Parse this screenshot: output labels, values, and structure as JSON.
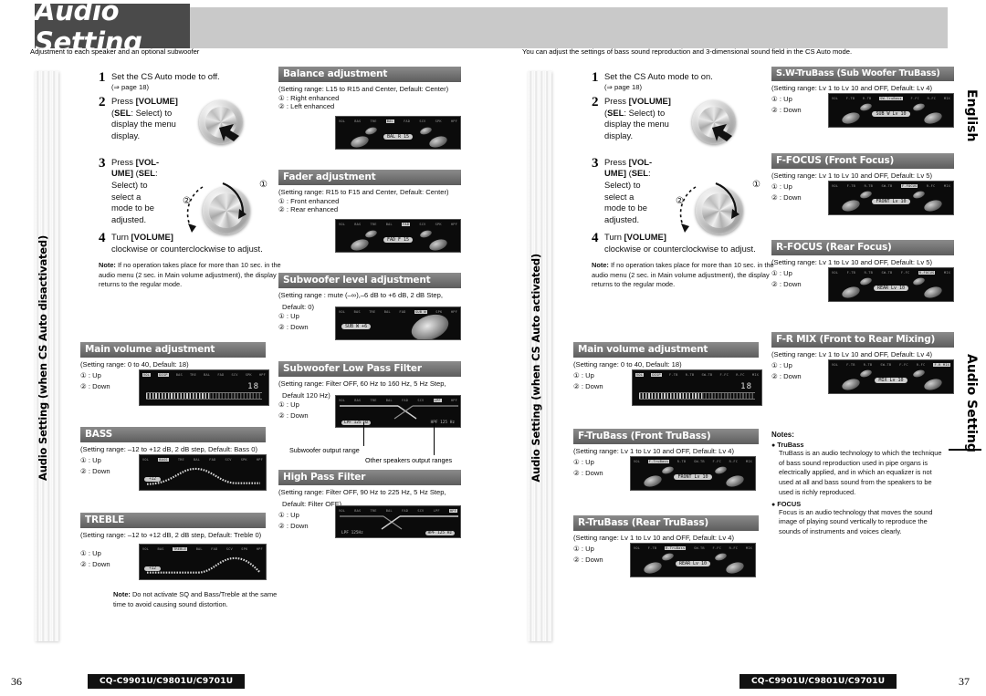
{
  "header": {
    "title": "Audio Setting",
    "subtitle_left": "Adjustment to each speaker and an optional subwoofer",
    "subtitle_right": "You can adjust the settings of bass sound reproduction and 3-dimensional sound field in the CS Auto mode."
  },
  "side_tabs": {
    "left": "Audio Setting (when CS Auto disactivated)",
    "right": "Audio Setting (when CS Auto activated)",
    "english": "English",
    "audio_setting": "Audio Setting"
  },
  "steps_left": {
    "s1_num": "1",
    "s1_text": "Set the CS Auto mode to off.",
    "s1_sub": "(⇒ page 18)",
    "s2_num": "2",
    "s2_text_a": "Press ",
    "s2_text_b": "[VOLUME]",
    "s2_text_c": "(",
    "s2_text_d": "SEL",
    "s2_text_e": ": Select) to display the menu display.",
    "s3_num": "3",
    "s3_text_a": "Press ",
    "s3_text_b": "[VOL-UME]",
    "s3_text_c": " (",
    "s3_text_d": "SEL",
    "s3_text_e": ": Select) to select a mode to be adjusted.",
    "s4_num": "4",
    "s4_text_a": "Turn ",
    "s4_text_b": "[VOLUME]",
    "s4_text_c": "clockwise or counterclockwise to adjust.",
    "note_label": "Note:",
    "note_text": " If no operation takes place for more than 10 sec. in the audio menu (2 sec. in Main volume adjustment), the display returns to the regular mode.",
    "knob_marks": {
      "one": "①",
      "two": "②"
    }
  },
  "steps_right": {
    "s1_num": "1",
    "s1_text": "Set the CS Auto mode to on.",
    "s1_sub": "(⇒ page 18)",
    "s2_num": "2",
    "s2_text_a": "Press ",
    "s2_text_b": "[VOLUME]",
    "s2_text_c": "(",
    "s2_text_d": "SEL",
    "s2_text_e": ": Select) to display the menu display.",
    "s3_num": "3",
    "s3_text_a": "Press ",
    "s3_text_b": "[VOL-UME]",
    "s3_text_c": " (",
    "s3_text_d": "SEL",
    "s3_text_e": ": Select) to select a mode to be adjusted.",
    "s4_num": "4",
    "s4_text_a": "Turn ",
    "s4_text_b": "[VOLUME]",
    "s4_text_c": "clockwise or counterclockwise to adjust.",
    "note_label": "Note:",
    "note_text": " If no operation takes place for more than 10 sec. in the audio menu (2 sec. in Main volume adjustment), the display returns to the regular mode."
  },
  "col1": {
    "main_volume": {
      "title": "Main volume adjustment",
      "range": "(Setting range: 0 to 40, Default: 18)",
      "opt1": "① : Up",
      "opt2": "② : Down",
      "lcd_top": [
        "VOL",
        "DISP",
        "BAS",
        "TRE",
        "BAL",
        "FAD",
        "SCV",
        "SPK",
        "HPF"
      ],
      "lcd_value": "18"
    },
    "bass": {
      "title": "BASS",
      "range": "(Setting range: –12 to +12 dB, 2 dB step, Default: Bass 0)",
      "opt1": "① : Up",
      "opt2": "② : Down",
      "lcd_top": [
        "VOL",
        "BASS",
        "TRE",
        "BAL",
        "FAD",
        "SCV",
        "SPK",
        "HPF"
      ],
      "lcd_tag": "+12"
    },
    "treble": {
      "title": "TREBLE",
      "range": "(Setting range: –12 to +12 dB, 2 dB step, Default: Treble 0)",
      "opt1": "① : Up",
      "opt2": "② : Down",
      "lcd_top": [
        "VOL",
        "BAS",
        "TREBLE",
        "BAL",
        "FAD",
        "SCV",
        "SPK",
        "HPF"
      ],
      "lcd_tag": "+12"
    },
    "bottom_note_label": "Note:",
    "bottom_note_text": " Do not activate SQ and Bass/Treble at the same time to avoid causing sound distortion."
  },
  "col2": {
    "balance": {
      "title": "Balance adjustment",
      "range": "(Setting range: L15 to R15 and Center, Default: Center)",
      "opt1": "① : Right enhanced",
      "opt2": "② : Left enhanced",
      "lcd_top": [
        "VOL",
        "BAS",
        "TRE",
        "BAL",
        "FAD",
        "SCV",
        "SPK",
        "HPF"
      ],
      "lcd_pill": "BAL R 15"
    },
    "fader": {
      "title": "Fader adjustment",
      "range": "(Setting range: R15 to F15 and Center, Default: Center)",
      "opt1": "① : Front enhanced",
      "opt2": "② : Rear enhanced",
      "lcd_top": [
        "VOL",
        "BAS",
        "TRE",
        "BAL",
        "FAD",
        "SCV",
        "SPK",
        "HPF"
      ],
      "lcd_pill": "FAD F 15"
    },
    "subwoofer_level": {
      "title": "Subwoofer level adjustment",
      "range": "(Setting range : mute (–∞),–6 dB to +6 dB, 2 dB Step,",
      "range2": "Default: 0)",
      "opt1": "① : Up",
      "opt2": "② : Down",
      "lcd_top": [
        "VOL",
        "BAS",
        "TRE",
        "BAL",
        "FAD",
        "SUB W",
        "SPK",
        "HPF"
      ],
      "lcd_pill": "SUB W  +6"
    },
    "sub_lpf": {
      "title": "Subwoofer Low Pass Filter",
      "range": "(Setting range: Filter OFF, 60 Hz to 160 Hz, 5 Hz Step,",
      "range2": "Default 120 Hz)",
      "opt1": "① : Up",
      "opt2": "② : Down",
      "lcd_top": [
        "VOL",
        "BAS",
        "TRE",
        "BAL",
        "FAD",
        "SCV",
        "LPF",
        "HPF"
      ],
      "lcd_left": "LPF  125 Hz",
      "lcd_right": "HPF   125 Hz",
      "callout_a": "Subwoofer output range",
      "callout_b": "Other speakers output ranges"
    },
    "hpf": {
      "title": "High Pass Filter",
      "range": "(Setting range: Filter OFF, 90 Hz to 225 Hz, 5 Hz Step,",
      "range2": "Default: Filter OFF)",
      "opt1": "① : Up",
      "opt2": "② : Down",
      "lcd_top": [
        "VOL",
        "BAS",
        "TRE",
        "BAL",
        "FAD",
        "SCV",
        "LPF",
        "HPF"
      ],
      "lcd_left": "LPF   125Hz",
      "lcd_right": "HPF   125 Hz"
    }
  },
  "col3": {
    "main_volume": {
      "title": "Main volume adjustment",
      "range": "(Setting range: 0 to 40, Default: 18)",
      "opt1": "① : Up",
      "opt2": "② : Down",
      "lcd_top": [
        "VOL",
        "DISP",
        "F-TB",
        "R-TB",
        "SW-TB",
        "F-FC",
        "R-FC",
        "MIX"
      ],
      "lcd_value": "18"
    },
    "f_trubass": {
      "title": "F-TruBass (Front TruBass)",
      "range": "(Setting range: Lv 1 to Lv 10 and OFF, Default: Lv 4)",
      "opt1": "① : Up",
      "opt2": "② : Down",
      "lcd_top": [
        "VOL",
        "F-TruBass",
        "R-TB",
        "SW-TB",
        "F-FC",
        "R-FC",
        "MIX"
      ],
      "lcd_pill": "FRONT  Lv 10"
    },
    "r_trubass": {
      "title": "R-TruBass (Rear TruBass)",
      "range": "(Setting range: Lv 1 to Lv 10 and OFF, Default: Lv 4)",
      "opt1": "① : Up",
      "opt2": "② : Down",
      "lcd_top": [
        "VOL",
        "F-TB",
        "R-TruBass",
        "SW-TB",
        "F-FC",
        "R-FC",
        "MIX"
      ],
      "lcd_pill": "REAR  Lv 10"
    }
  },
  "col4": {
    "sw_trubass": {
      "title": "S.W-TruBass (Sub Woofer TruBass)",
      "range": "(Setting range: Lv 1 to Lv 10 and OFF, Default: Lv 4)",
      "opt1": "① : Up",
      "opt2": "② : Down",
      "lcd_top": [
        "VOL",
        "F-TB",
        "R-TB",
        "SW-TruBass",
        "F-FC",
        "R-FC",
        "MIX"
      ],
      "lcd_pill": "SUB W  Lv 10"
    },
    "f_focus": {
      "title": "F-FOCUS (Front Focus)",
      "range": "(Setting range: Lv 1 to Lv 10 and OFF, Default: Lv 5)",
      "opt1": "① : Up",
      "opt2": "② : Down",
      "lcd_top": [
        "VOL",
        "F-TB",
        "R-TB",
        "SW-TB",
        "F-FOCUS",
        "R-FC",
        "MIX"
      ],
      "lcd_pill": "FRONT  Lv 10"
    },
    "r_focus": {
      "title": "R-FOCUS (Rear Focus)",
      "range": "(Setting range: Lv 1 to Lv 10 and OFF, Default: Lv 5)",
      "opt1": "① : Up",
      "opt2": "② : Down",
      "lcd_top": [
        "VOL",
        "F-TB",
        "R-TB",
        "SW-TB",
        "F-FC",
        "R-FOCUS",
        "MIX"
      ],
      "lcd_pill": "REAR  Lv 10"
    },
    "fr_mix": {
      "title": "F-R MIX (Front to Rear Mixing)",
      "range": "(Setting range: Lv 1 to Lv 10 and OFF, Default: Lv 4)",
      "opt1": "① : Up",
      "opt2": "② : Down",
      "lcd_top": [
        "VOL",
        "F-TB",
        "R-TB",
        "SW-TB",
        "F-FC",
        "R-FC",
        "F-R MIX"
      ],
      "lcd_pill": "MIX  Lv 10"
    },
    "notes": {
      "head": "Notes:",
      "item1_title": "TruBass",
      "item1_body": "TruBass is an audio technology to which the technique of bass sound reproduction used in pipe organs is electrically applied, and in which an equalizer is not used at all and bass sound from the speakers to be used is richly reproduced.",
      "item2_title": "FOCUS",
      "item2_body": "Focus is an audio technology that moves the sound image of playing sound vertically to reproduce the sounds of instruments and voices clearly."
    }
  },
  "footer": {
    "model_left": "CQ-C9901U/C9801U/C9701U",
    "model_right": "CQ-C9901U/C9801U/C9701U",
    "page_left": "36",
    "page_right": "37"
  }
}
